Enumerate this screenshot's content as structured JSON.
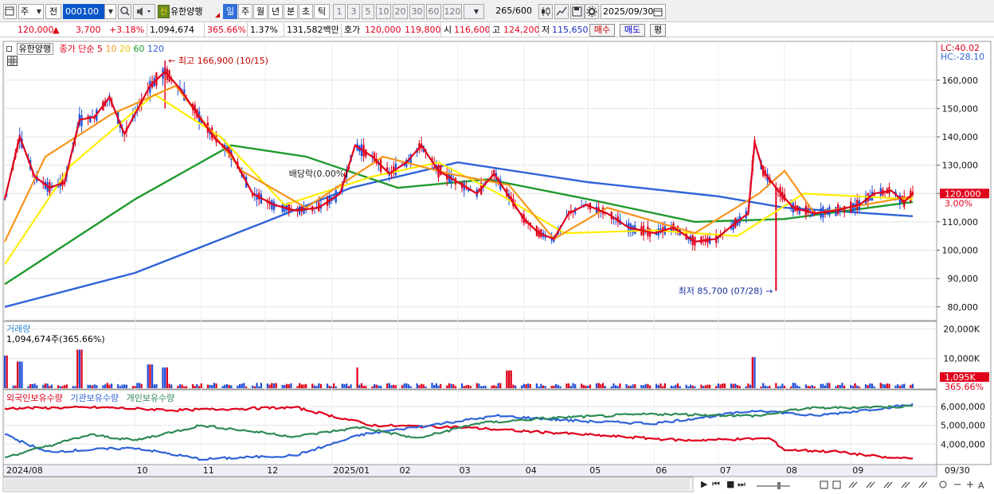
{
  "toolbar": {
    "period_jo": "주",
    "jeon": "전",
    "code": "000100",
    "badge": "신",
    "name": "유한양행",
    "tabs": [
      "일",
      "주",
      "월",
      "년",
      "분",
      "초",
      "틱"
    ],
    "active_tab": "일",
    "numbers": [
      "1",
      "3",
      "5",
      "10",
      "20",
      "30",
      "60",
      "120"
    ],
    "count": "265",
    "count_total": "/600",
    "date": "2025/09/30"
  },
  "quote": {
    "price": "120,000",
    "change": "3,700",
    "change_pct": "+3.18%",
    "volume": "1,094,674",
    "vol_ratio": "365.66%",
    "turnover": "1.37%",
    "amount": "131,582백만",
    "hoga_label": "호가",
    "hoga_ask": "120,000",
    "hoga_bid": "119,800",
    "open_label": "시",
    "open": "116,600",
    "high_label": "고",
    "high": "124,200",
    "low_label": "저",
    "low": "115,650",
    "buy_label": "매수",
    "sell_label": "매도",
    "avg_label": "평"
  },
  "price_panel": {
    "name_tag": "유한양행",
    "legend_title": "종가 단순",
    "ma_periods": [
      "5",
      "10",
      "20",
      "60",
      "120"
    ],
    "ma_colors": [
      "#e0001b",
      "#f7941d",
      "#ffee00",
      "#1f9a2c",
      "#2f63d8"
    ],
    "high_annotation": "최고 166,900 (10/15)",
    "low_annotation": "최저 85,700 (07/28)",
    "dividend_annotation": "배당락(0.00%)",
    "lc": "LC:40.02",
    "hc": "HC:-28.10",
    "price_tag": "120,000",
    "pct_tag": "3.00%"
  },
  "volume_panel": {
    "title": "거래량",
    "info": "1,094,674주(365.66%)",
    "vol_tag": "1,095K",
    "pct_tag": "365.66%"
  },
  "holding_panel": {
    "legend": [
      "외국인보유수량",
      "기관보유수량",
      "개인보유수량"
    ],
    "colors": [
      "#e0001b",
      "#2f63d8",
      "#2e8b57"
    ]
  },
  "bottom_controls": {
    "play": "▶",
    "first": "⏮",
    "stop": "■",
    "last": "⏭"
  },
  "chart_data": [
    {
      "type": "candlestick",
      "title": "유한양행",
      "y_ticks": [
        "160,000",
        "150,000",
        "140,000",
        "130,000",
        "120,000",
        "110,000",
        "100,000",
        "90,000",
        "80,000"
      ],
      "ylim": [
        76000,
        172000
      ],
      "x_ticks": [
        "2024/08",
        "10",
        "11",
        "12",
        "2025/01",
        "02",
        "03",
        "04",
        "05",
        "06",
        "07",
        "08",
        "09",
        "09/30"
      ],
      "close_path": [
        [
          "2024-08-01",
          118000
        ],
        [
          "2024-08-08",
          140000
        ],
        [
          "2024-08-15",
          126000
        ],
        [
          "2024-08-22",
          122000
        ],
        [
          "2024-08-29",
          124000
        ],
        [
          "2024-09-05",
          146000
        ],
        [
          "2024-09-12",
          147000
        ],
        [
          "2024-09-19",
          154000
        ],
        [
          "2024-09-26",
          141000
        ],
        [
          "2024-10-08",
          158000
        ],
        [
          "2024-10-15",
          163000
        ],
        [
          "2024-10-22",
          157000
        ],
        [
          "2024-11-01",
          146000
        ],
        [
          "2024-11-08",
          139000
        ],
        [
          "2024-11-15",
          134000
        ],
        [
          "2024-11-25",
          120000
        ],
        [
          "2024-12-05",
          116000
        ],
        [
          "2024-12-15",
          114000
        ],
        [
          "2024-12-26",
          115000
        ],
        [
          "2025-01-05",
          120000
        ],
        [
          "2025-01-12",
          137000
        ],
        [
          "2025-01-20",
          133000
        ],
        [
          "2025-01-28",
          127000
        ],
        [
          "2025-02-05",
          131000
        ],
        [
          "2025-02-12",
          137000
        ],
        [
          "2025-02-20",
          128000
        ],
        [
          "2025-03-01",
          124000
        ],
        [
          "2025-03-10",
          120000
        ],
        [
          "2025-03-18",
          127000
        ],
        [
          "2025-03-25",
          119000
        ],
        [
          "2025-04-01",
          111000
        ],
        [
          "2025-04-08",
          106000
        ],
        [
          "2025-04-15",
          104000
        ],
        [
          "2025-04-22",
          113000
        ],
        [
          "2025-04-30",
          116000
        ],
        [
          "2025-05-10",
          113000
        ],
        [
          "2025-05-20",
          108000
        ],
        [
          "2025-06-01",
          106000
        ],
        [
          "2025-06-10",
          108000
        ],
        [
          "2025-06-20",
          103000
        ],
        [
          "2025-06-30",
          104000
        ],
        [
          "2025-07-08",
          109000
        ],
        [
          "2025-07-15",
          113000
        ],
        [
          "2025-07-18",
          138000
        ],
        [
          "2025-07-22",
          128000
        ],
        [
          "2025-07-28",
          122000
        ],
        [
          "2025-08-05",
          115000
        ],
        [
          "2025-08-15",
          113000
        ],
        [
          "2025-08-25",
          114000
        ],
        [
          "2025-09-05",
          116000
        ],
        [
          "2025-09-12",
          120000
        ],
        [
          "2025-09-20",
          121000
        ],
        [
          "2025-09-26",
          117000
        ],
        [
          "2025-09-30",
          120000
        ]
      ],
      "ma120_path": [
        [
          "2024-08-01",
          80000
        ],
        [
          "2024-10-01",
          92000
        ],
        [
          "2024-12-01",
          110000
        ],
        [
          "2025-01-10",
          122000
        ],
        [
          "2025-03-01",
          131000
        ],
        [
          "2025-05-01",
          124000
        ],
        [
          "2025-07-01",
          119000
        ],
        [
          "2025-08-01",
          115000
        ],
        [
          "2025-09-30",
          112000
        ]
      ],
      "ma60_path": [
        [
          "2024-08-01",
          88000
        ],
        [
          "2024-10-01",
          118000
        ],
        [
          "2024-11-15",
          137000
        ],
        [
          "2024-12-20",
          133000
        ],
        [
          "2025-02-01",
          122000
        ],
        [
          "2025-03-15",
          125000
        ],
        [
          "2025-05-01",
          118000
        ],
        [
          "2025-06-20",
          110000
        ],
        [
          "2025-08-01",
          111000
        ],
        [
          "2025-09-30",
          117000
        ]
      ],
      "ma20_path": [
        [
          "2024-08-01",
          95000
        ],
        [
          "2024-09-01",
          130000
        ],
        [
          "2024-10-10",
          155000
        ],
        [
          "2024-11-10",
          140000
        ],
        [
          "2024-12-10",
          116000
        ],
        [
          "2025-01-20",
          126000
        ],
        [
          "2025-02-20",
          131000
        ],
        [
          "2025-03-20",
          120000
        ],
        [
          "2025-04-20",
          106000
        ],
        [
          "2025-06-01",
          107000
        ],
        [
          "2025-07-10",
          105000
        ],
        [
          "2025-08-10",
          120000
        ],
        [
          "2025-09-30",
          118000
        ]
      ],
      "ma10_path": [
        [
          "2024-08-01",
          103000
        ],
        [
          "2024-08-20",
          133000
        ],
        [
          "2024-09-20",
          148000
        ],
        [
          "2024-10-20",
          158000
        ],
        [
          "2024-11-20",
          128000
        ],
        [
          "2024-12-20",
          115000
        ],
        [
          "2025-01-25",
          133000
        ],
        [
          "2025-02-25",
          127000
        ],
        [
          "2025-03-25",
          123000
        ],
        [
          "2025-04-15",
          104000
        ],
        [
          "2025-05-10",
          115000
        ],
        [
          "2025-06-20",
          106000
        ],
        [
          "2025-07-20",
          120000
        ],
        [
          "2025-08-01",
          128000
        ],
        [
          "2025-08-15",
          113000
        ],
        [
          "2025-09-30",
          119000
        ]
      ],
      "high": {
        "date": "2024-10-15",
        "value": 166900
      },
      "low": {
        "date": "2025-07-28",
        "value": 85700
      }
    },
    {
      "type": "bar",
      "title": "거래량",
      "y_ticks": [
        "20,000K",
        "10,000K"
      ],
      "ylim": [
        0,
        22000
      ],
      "unit": "K shares",
      "spikes": [
        [
          "2024-08-01",
          11000
        ],
        [
          "2024-08-08",
          9000
        ],
        [
          "2024-09-05",
          13000
        ],
        [
          "2024-10-08",
          8000
        ],
        [
          "2024-10-15",
          7000
        ],
        [
          "2025-01-12",
          7000
        ],
        [
          "2025-03-25",
          6000
        ],
        [
          "2025-07-18",
          10500
        ],
        [
          "2025-09-30",
          1095
        ]
      ],
      "base_level": 1400
    },
    {
      "type": "line",
      "title": "보유수량",
      "y_ticks": [
        "6,000,000",
        "5,000,000",
        "4,000,000"
      ],
      "ylim": [
        3000000,
        6800000
      ],
      "series": [
        {
          "name": "외국인보유수량",
          "points": [
            [
              "2024-08-01",
              5900000
            ],
            [
              "2024-09-15",
              5950000
            ],
            [
              "2024-10-20",
              5800000
            ],
            [
              "2024-12-15",
              5950000
            ],
            [
              "2025-01-20",
              5000000
            ],
            [
              "2025-03-01",
              4900000
            ],
            [
              "2025-04-15",
              4600000
            ],
            [
              "2025-06-15",
              4200000
            ],
            [
              "2025-07-25",
              4300000
            ],
            [
              "2025-08-01",
              3700000
            ],
            [
              "2025-08-25",
              3600000
            ],
            [
              "2025-09-20",
              3250000
            ],
            [
              "2025-09-30",
              3300000
            ]
          ]
        },
        {
          "name": "기관보유수량",
          "points": [
            [
              "2024-08-01",
              4500000
            ],
            [
              "2024-08-20",
              3600000
            ],
            [
              "2024-10-01",
              3800000
            ],
            [
              "2024-11-01",
              3200000
            ],
            [
              "2024-12-15",
              3400000
            ],
            [
              "2025-01-15",
              4500000
            ],
            [
              "2025-02-15",
              5000000
            ],
            [
              "2025-03-20",
              5500000
            ],
            [
              "2025-05-01",
              5200000
            ],
            [
              "2025-06-01",
              5100000
            ],
            [
              "2025-07-20",
              5800000
            ],
            [
              "2025-08-15",
              5500000
            ],
            [
              "2025-09-30",
              6100000
            ]
          ]
        },
        {
          "name": "개인보유수량",
          "points": [
            [
              "2024-08-01",
              3300000
            ],
            [
              "2024-09-10",
              4500000
            ],
            [
              "2024-10-01",
              4200000
            ],
            [
              "2024-11-01",
              5000000
            ],
            [
              "2024-12-15",
              4400000
            ],
            [
              "2025-01-15",
              4900000
            ],
            [
              "2025-02-10",
              4300000
            ],
            [
              "2025-03-10",
              5100000
            ],
            [
              "2025-04-15",
              5400000
            ],
            [
              "2025-06-01",
              5600000
            ],
            [
              "2025-07-20",
              5500000
            ],
            [
              "2025-08-10",
              5900000
            ],
            [
              "2025-09-30",
              6000000
            ]
          ]
        }
      ]
    }
  ]
}
